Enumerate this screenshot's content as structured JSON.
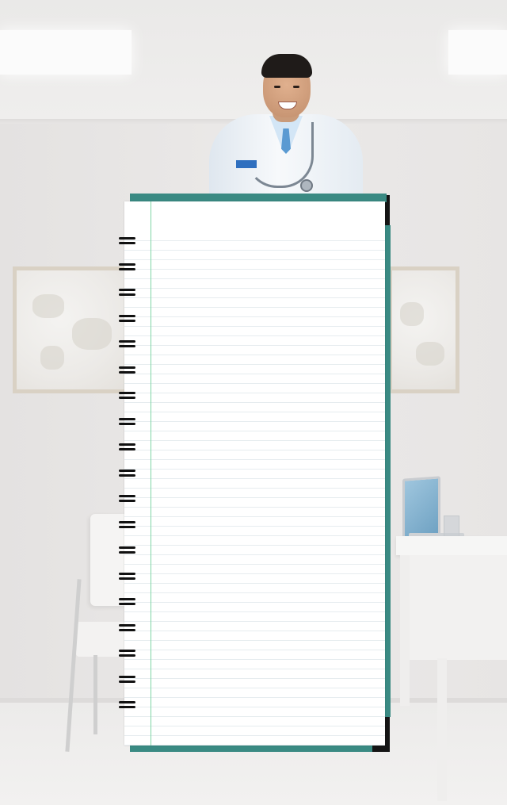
{
  "scene": {
    "description_visible_text": ""
  },
  "notebook": {
    "ring_count": 19,
    "cover_color": "#3a8a83",
    "margin_line_color": "#7fd6a6",
    "rule_line_color": "#e6ecef"
  },
  "icons": [
    "doctor-portrait",
    "stethoscope-icon",
    "spiral-binding-rings"
  ]
}
